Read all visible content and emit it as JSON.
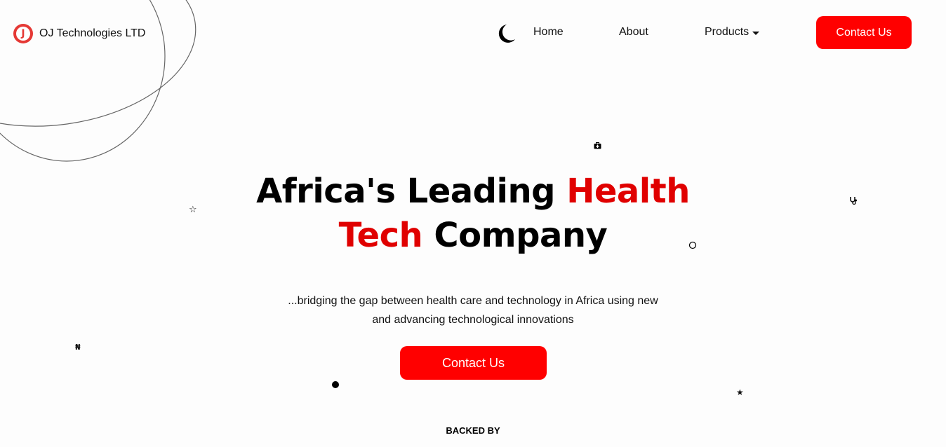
{
  "header": {
    "brand_name": "OJ Technologies LTD",
    "logo_letter": "J"
  },
  "nav": {
    "home": "Home",
    "about": "About",
    "products": "Products",
    "contact_button": "Contact Us"
  },
  "hero": {
    "title_part1": "Africa's Leading ",
    "title_highlight1": "Health",
    "title_highlight2": "Tech",
    "title_part2": " Company",
    "subtitle_line1": "...bridging the gap between health care and technology in Africa using new",
    "subtitle_line2": "and advancing technological innovations",
    "cta_button": "Contact Us"
  },
  "backed_by": "BACKED BY",
  "floating_icons": {
    "naira": "₦",
    "star_outline": "☆",
    "star_filled": "★"
  },
  "colors": {
    "accent": "#ff0000",
    "highlight_text": "#e00000",
    "logo": "#e53935"
  }
}
